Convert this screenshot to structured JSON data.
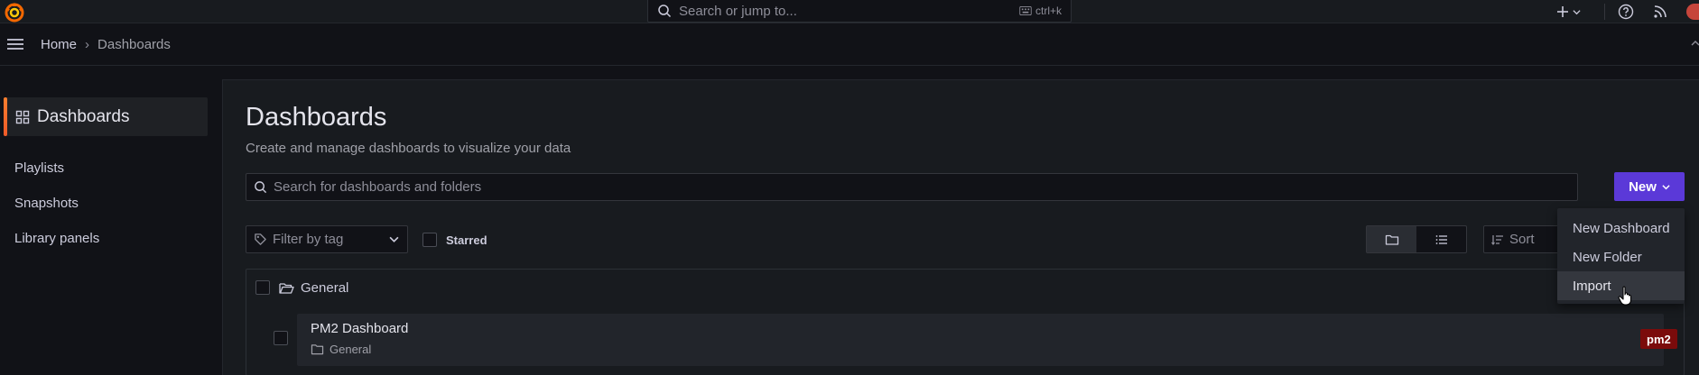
{
  "topbar": {
    "search_placeholder": "Search or jump to...",
    "search_shortcut": "ctrl+k",
    "icons": [
      "grafana-logo-icon",
      "search-icon",
      "keyboard-icon",
      "plus-icon",
      "chevron-down-icon",
      "help-icon",
      "rss-icon",
      "avatar"
    ]
  },
  "breadcrumb": {
    "home": "Home",
    "separator": "›",
    "current": "Dashboards"
  },
  "sidebar": {
    "active_label": "Dashboards",
    "items": [
      "Playlists",
      "Snapshots",
      "Library panels"
    ]
  },
  "main": {
    "title": "Dashboards",
    "subtitle": "Create and manage dashboards to visualize your data",
    "search_placeholder": "Search for dashboards and folders",
    "new_button": "New",
    "filter_tag_placeholder": "Filter by tag",
    "starred_label": "Starred",
    "sort_placeholder": "Sort",
    "folder": {
      "name": "General",
      "dashboards": [
        {
          "title": "PM2 Dashboard",
          "folder": "General",
          "tag": "pm2"
        }
      ]
    }
  },
  "new_menu": {
    "items": [
      "New Dashboard",
      "New Folder",
      "Import"
    ],
    "hovered": "Import"
  },
  "colors": {
    "primary": "#5b39d8",
    "accent": "#f05a28",
    "tag_pm2": "#7b0b0b"
  }
}
